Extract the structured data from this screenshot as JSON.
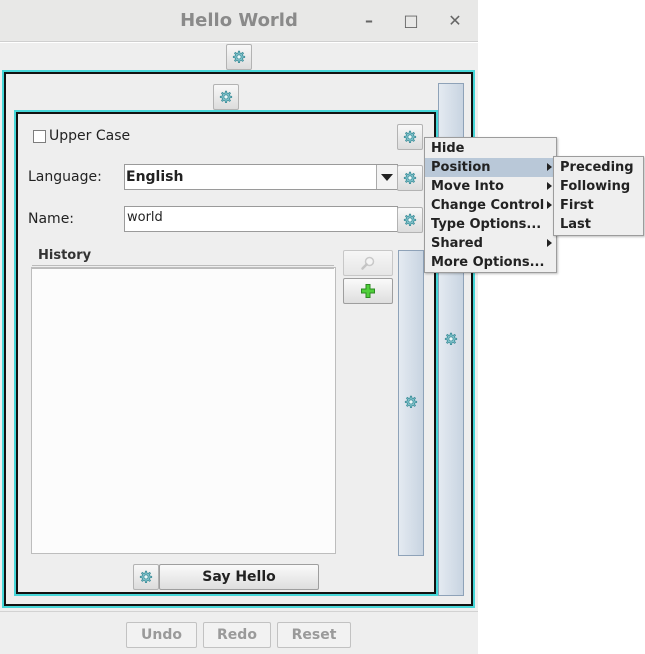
{
  "window": {
    "title": "Hello World",
    "minimize_glyph": "–",
    "maximize_glyph": "□",
    "close_glyph": "✕"
  },
  "form": {
    "upper_case_label": "Upper Case",
    "upper_case_checked": false,
    "language_label": "Language:",
    "language_value": "English",
    "name_label": "Name:",
    "name_value": "world",
    "history_title": "History",
    "say_hello_label": "Say Hello"
  },
  "bottom": {
    "undo": "Undo",
    "redo": "Redo",
    "reset": "Reset"
  },
  "context_menu": {
    "items": [
      "Hide",
      "Position",
      "Move Into",
      "Change Control",
      "Type Options...",
      "Shared",
      "More Options..."
    ],
    "selected": "Position"
  },
  "submenu": {
    "items": [
      "Preceding",
      "Following",
      "First",
      "Last"
    ]
  },
  "colors": {
    "frame_highlight": "#46d6d8",
    "menu_selected": "#b9c8d8",
    "gear_icon": "#5aaab5"
  },
  "icons": {
    "gear": "gear-icon",
    "search": "magnifier-icon",
    "add": "green-plus-icon"
  }
}
